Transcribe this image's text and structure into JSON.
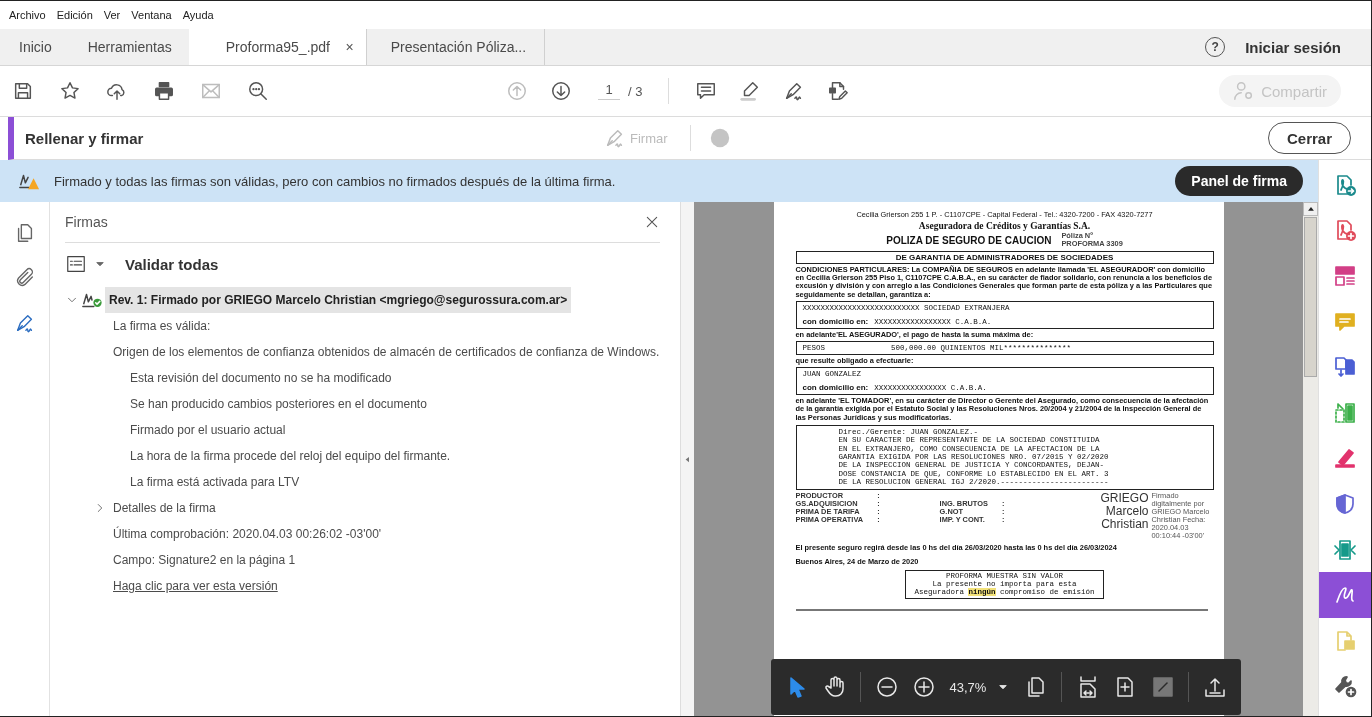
{
  "menu": [
    "Archivo",
    "Edición",
    "Ver",
    "Ventana",
    "Ayuda"
  ],
  "tabs": [
    {
      "label": "Inicio",
      "kind": "nav",
      "selected": false
    },
    {
      "label": "Herramientas",
      "kind": "nav",
      "selected": false
    },
    {
      "label": "Proforma95_.pdf",
      "kind": "doc",
      "selected": true,
      "close": "×"
    },
    {
      "label": "Presentación Póliza...",
      "kind": "doc",
      "selected": false
    }
  ],
  "help": "?",
  "signin": "Iniciar sesión",
  "toolbar": {
    "tools": [
      {
        "kind": "save",
        "disabled": false
      },
      {
        "kind": "star",
        "disabled": false
      },
      {
        "kind": "cloud",
        "disabled": false
      },
      {
        "kind": "print",
        "disabled": false
      },
      {
        "kind": "mail",
        "disabled": true
      },
      {
        "kind": "search",
        "disabled": false
      }
    ],
    "nav": [
      {
        "kind": "up",
        "disabled": true
      },
      {
        "kind": "down",
        "disabled": false
      }
    ],
    "page": "1",
    "page_total": "/ 3",
    "edit_tools": [
      {
        "kind": "comment"
      },
      {
        "kind": "highlight"
      },
      {
        "kind": "sign"
      },
      {
        "kind": "editdoc"
      }
    ],
    "share": {
      "label": "Compartir",
      "disabled": true
    }
  },
  "fill_sign": {
    "title": "Rellenar y firmar",
    "sign": {
      "label": "Firmar",
      "disabled": true
    },
    "close": "Cerrar"
  },
  "notice": {
    "text": "Firmado y todas las firmas son válidas, pero con cambios no firmados después de la última firma.",
    "button": "Panel de firma"
  },
  "rail": [
    {
      "kind": "pages",
      "selected": false
    },
    {
      "kind": "clip",
      "selected": false
    },
    {
      "kind": "sign",
      "selected": true
    }
  ],
  "signatures": {
    "title": "Firmas",
    "validate": "Validar todas",
    "signature": {
      "label": "Rev. 1: Firmado por GRIEGO Marcelo Christian <mgriego@segurossura.com.ar>",
      "expanded": true,
      "selected": true,
      "lines": [
        {
          "kind": "text",
          "text": "La firma es válida:"
        },
        {
          "kind": "text",
          "text": "Origen de los elementos de confianza obtenidos de almacén de certificados de confianza de Windows.",
          "children": [
            {
              "kind": "text",
              "text": "Esta revisión del documento no se ha modificado"
            },
            {
              "kind": "text",
              "text": "Se han producido cambios posteriores en el documento"
            },
            {
              "kind": "text",
              "text": "Firmado por el usuario actual"
            },
            {
              "kind": "text",
              "text": "La hora de la firma procede del reloj del equipo del firmante."
            },
            {
              "kind": "text",
              "text": "La firma está activada para LTV"
            }
          ]
        },
        {
          "kind": "expander",
          "text": "Detalles de la firma",
          "expanded": false
        },
        {
          "kind": "text",
          "text": "Última comprobación: 2020.04.03 00:26:02 -03'00'"
        },
        {
          "kind": "text",
          "text": "Campo: Signature2 en la página 1"
        },
        {
          "kind": "link",
          "text": "Haga clic para ver esta versión"
        }
      ]
    }
  },
  "document": {
    "address": "Cecilia Grierson 255 1 P. - C1107CPE - Capital Federal - Tel.: 4320-7200 - FAX 4320-7277",
    "company": "Aseguradora de Créditos y Garantías S.A.",
    "title": "POLIZA DE SEGURO DE CAUCION",
    "policy_label": "Póliza Nº",
    "policy_number": "PROFORMA 3309",
    "section": "DE GARANTIA DE ADMINISTRADORES DE SOCIEDADES",
    "blocks": [
      {
        "kind": "para",
        "text": "CONDICIONES PARTICULARES: La COMPAÑIA DE SEGUROS en adelante llamada 'EL ASEGURADOR' con domicilio en Cecilia Grierson 255 Piso 1, C1107CPE C.A.B.A., en su carácter de fiador solidario, con renuncia a los beneficios de excusión y división y con arreglo a las Condiciones Generales que forman parte de esta póliza y a las Particulares que seguidamente se detallan, garantiza a:"
      },
      {
        "kind": "box",
        "lines": [
          {
            "cells": [
              "XXXXXXXXXXXXXXXXXXXXXXXXXX SOCIEDAD EXTRANJERA"
            ]
          },
          {
            "label": "con domicilio en:",
            "cells": [
              "XXXXXXXXXXXXXXXXX C.A.B.A."
            ]
          }
        ]
      },
      {
        "kind": "para",
        "text": "en adelante'EL ASEGURADO', el pago de hasta la suma máxima de:"
      },
      {
        "kind": "box",
        "lines": [
          {
            "cells": [
              "PESOS",
              "500,000.00 QUINIENTOS MIL***************"
            ]
          }
        ]
      },
      {
        "kind": "para",
        "text": "que resulte obligado a efectuarle:"
      },
      {
        "kind": "box",
        "lines": [
          {
            "cells": [
              "JUAN GONZALEZ"
            ]
          },
          {
            "label": "con domicilio en:",
            "cells": [
              "XXXXXXXXXXXXXXXX C.A.B.A."
            ]
          }
        ]
      },
      {
        "kind": "para",
        "text": "en adelante 'EL TOMADOR', en su carácter de Director o Gerente del Asegurado, como consecuencia de la afectación de la garantía exigida por el Estatuto Social y las Resoluciones Nros. 20/2004 y 21/2004 de la Inspección General de las Personas Jurídicas y sus modificatorias."
      },
      {
        "kind": "memo",
        "lines": [
          "Direc./Gerente: JUAN GONZALEZ.-",
          "EN SU CARACTER DE REPRESENTANTE DE LA SOCIEDAD CONSTITUIDA",
          "EN EL EXTRANJERO, COMO CONSECUENCIA DE LA AFECTACION DE LA",
          "GARANTIA EXIGIDA POR LAS RESOLUCIONES NRO. 07/2015 Y 02/2020",
          "DE LA INSPECCION GENERAL DE JUSTICIA Y CONCORDANTES, DEJAN-",
          "DOSE CONSTANCIA DE QUE, CONFORME LO ESTABLECIDO EN EL ART. 3",
          "DE LA RESOLUCION GENERAL IGJ 2/2020.------------------------"
        ]
      },
      {
        "kind": "fields",
        "left": [
          {
            "label": "PRODUCTOR",
            "sep": ":"
          },
          {
            "label": "GS.ADQUISICION",
            "sep": ":"
          },
          {
            "label": "PRIMA DE TARIFA",
            "sep": ":"
          },
          {
            "label": "PRIMA OPERATIVA",
            "sep": ":"
          }
        ],
        "right": [
          {
            "label": "ING. BRUTOS",
            "sep": ":"
          },
          {
            "label": "G.NOT",
            "sep": ":"
          },
          {
            "label": "IMP. Y CONT.",
            "sep": ":"
          }
        ],
        "stamp": {
          "name_lines": [
            "GRIEGO",
            "Marcelo",
            "Christian"
          ],
          "details": "Firmado digitalmente por GRIEGO Marcelo Christian Fecha: 2020.04.03 00:10:44 -03'00'"
        }
      },
      {
        "kind": "strong",
        "text": "El presente seguro regirá desde las 0 hs del día 26/03/2020 hasta las 0 hs del día 26/03/2024"
      },
      {
        "kind": "strong",
        "text": "Buenos Aires, 24 de Marzo de 2020"
      },
      {
        "kind": "notice",
        "lines": [
          "PROFORMA MUESTRA SIN VALOR",
          "La presente no importa para esta",
          "Aseguradora **ningún** compromiso de emisión"
        ]
      },
      {
        "kind": "fineprint"
      }
    ]
  },
  "float_toolbar": [
    {
      "kind": "pointer",
      "selected": true
    },
    {
      "kind": "hand",
      "selected": false
    },
    {
      "kind": "separator"
    },
    {
      "kind": "zoomout"
    },
    {
      "kind": "zoomin"
    },
    {
      "kind": "zoom",
      "value": "43,7%"
    },
    {
      "kind": "pages"
    },
    {
      "kind": "separator"
    },
    {
      "kind": "fitwidth"
    },
    {
      "kind": "fitpage"
    },
    {
      "kind": "fullscreen",
      "disabled": true
    },
    {
      "kind": "separator"
    },
    {
      "kind": "upload"
    }
  ],
  "right_tools": [
    {
      "kind": "export",
      "color": "#1b8a8c",
      "selected": false
    },
    {
      "kind": "create",
      "color": "#e04a5a",
      "selected": false
    },
    {
      "kind": "layout",
      "color": "#d23f86",
      "selected": false
    },
    {
      "kind": "bubble",
      "color": "#e0b020",
      "selected": false
    },
    {
      "kind": "combine",
      "color": "#4b5fd4",
      "selected": false
    },
    {
      "kind": "frames",
      "color": "#3cb04a",
      "selected": false
    },
    {
      "kind": "marker",
      "color": "#e2336d",
      "selected": false
    },
    {
      "kind": "shield",
      "color": "#6666d4",
      "selected": false
    },
    {
      "kind": "compress",
      "color": "#169a8a",
      "selected": false
    },
    {
      "kind": "signature",
      "color": "#8c4fd6",
      "selected": true
    },
    {
      "kind": "note",
      "color": "#e6cf70",
      "selected": false
    },
    {
      "kind": "wrench",
      "color": "#555555",
      "selected": false
    }
  ]
}
